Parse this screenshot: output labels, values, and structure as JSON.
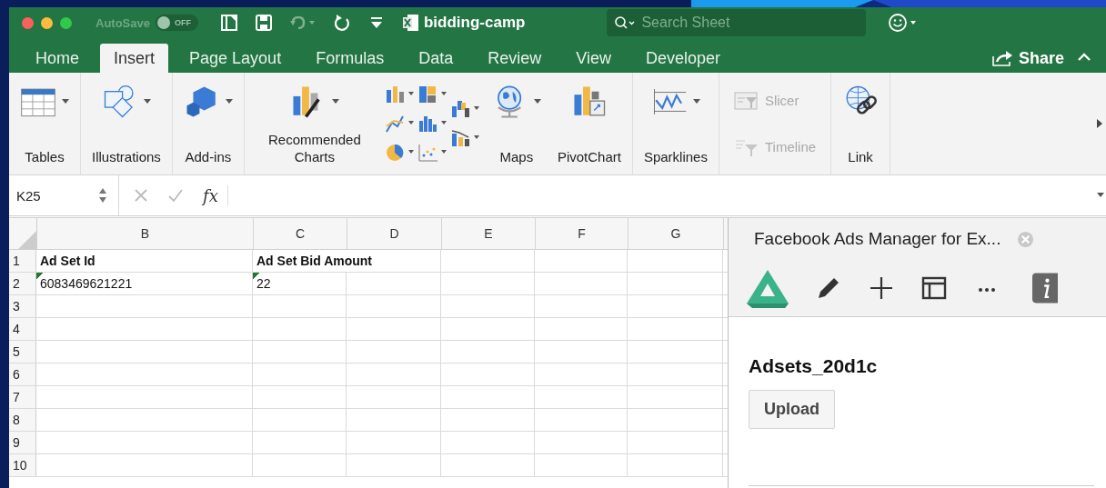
{
  "titlebar": {
    "autosave_label": "AutoSave",
    "autosave_toggle": {
      "label": "OFF",
      "on": false
    },
    "document_title": "bidding-camp",
    "search": {
      "placeholder": "Search Sheet"
    }
  },
  "tabs": [
    {
      "label": "Home",
      "selected": false
    },
    {
      "label": "Insert",
      "selected": true
    },
    {
      "label": "Page Layout",
      "selected": false
    },
    {
      "label": "Formulas",
      "selected": false
    },
    {
      "label": "Data",
      "selected": false
    },
    {
      "label": "Review",
      "selected": false
    },
    {
      "label": "View",
      "selected": false
    },
    {
      "label": "Developer",
      "selected": false
    }
  ],
  "share": {
    "label": "Share"
  },
  "ribbon": {
    "groups": [
      {
        "items": [
          {
            "kind": "large",
            "label": "Tables",
            "dropdown": true
          }
        ]
      },
      {
        "items": [
          {
            "kind": "large",
            "label": "Illustrations",
            "dropdown": true
          }
        ]
      },
      {
        "items": [
          {
            "kind": "large",
            "label": "Add-ins",
            "dropdown": true
          }
        ]
      },
      {
        "items": [
          {
            "kind": "large",
            "label": "Recommended Charts",
            "dropdown": true
          },
          {
            "kind": "icon-cluster"
          },
          {
            "kind": "large",
            "label": "Maps",
            "dropdown": true
          },
          {
            "kind": "large",
            "label": "PivotChart",
            "dropdown": false
          }
        ]
      },
      {
        "items": [
          {
            "kind": "large",
            "label": "Sparklines",
            "dropdown": true
          }
        ]
      },
      {
        "items": [
          {
            "kind": "small",
            "label": "Slicer",
            "disabled": true
          },
          {
            "kind": "small",
            "label": "Timeline",
            "disabled": true
          }
        ]
      },
      {
        "items": [
          {
            "kind": "large",
            "label": "Link",
            "dropdown": false
          }
        ]
      }
    ]
  },
  "formula_bar": {
    "name_box": "K25",
    "function_label": "fx"
  },
  "sheet": {
    "columns": [
      "B",
      "C",
      "D",
      "E",
      "F",
      "G"
    ],
    "rows": [
      {
        "number": "1",
        "cells": [
          {
            "text": "Ad Set Id",
            "bold": true,
            "flag": false
          },
          {
            "text": "Ad Set Bid Amount",
            "bold": true,
            "flag": false
          }
        ]
      },
      {
        "number": "2",
        "cells": [
          {
            "text": "6083469621221",
            "bold": false,
            "flag": true
          },
          {
            "text": "22",
            "bold": false,
            "flag": true
          }
        ]
      },
      {
        "number": "3"
      },
      {
        "number": "4"
      },
      {
        "number": "5"
      },
      {
        "number": "6"
      },
      {
        "number": "7"
      },
      {
        "number": "8"
      },
      {
        "number": "9"
      },
      {
        "number": "10"
      }
    ]
  },
  "task_pane": {
    "title": "Facebook Ads Manager for Ex...",
    "heading": "Adsets_20d1c",
    "button": "Upload"
  }
}
